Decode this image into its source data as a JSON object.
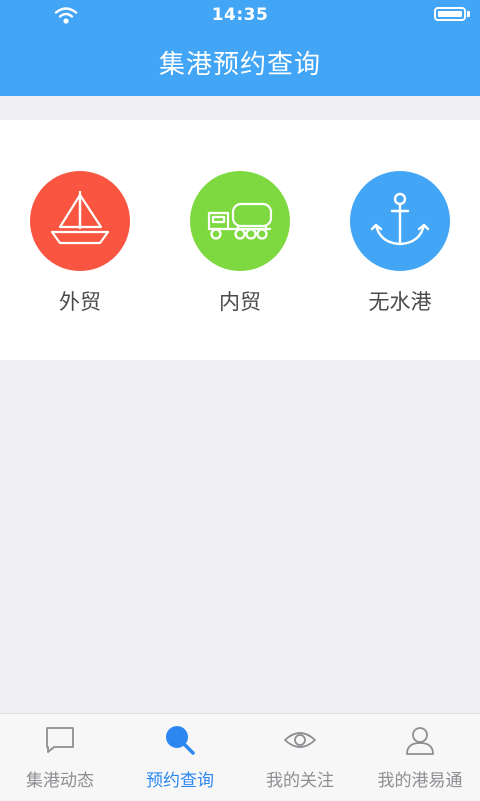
{
  "status_bar": {
    "time": "14:35"
  },
  "header": {
    "title": "集港预约查询"
  },
  "menu": [
    {
      "label": "外贸",
      "icon": "sailboat-icon",
      "color": "#fa5540"
    },
    {
      "label": "内贸",
      "icon": "truck-icon",
      "color": "#7ed940"
    },
    {
      "label": "无水港",
      "icon": "anchor-icon",
      "color": "#42a5f5"
    }
  ],
  "tabs": [
    {
      "label": "集港动态",
      "icon": "chat-bubble-icon",
      "active": false
    },
    {
      "label": "预约查询",
      "icon": "search-icon",
      "active": true
    },
    {
      "label": "我的关注",
      "icon": "eye-icon",
      "active": false
    },
    {
      "label": "我的港易通",
      "icon": "user-icon",
      "active": false
    }
  ],
  "colors": {
    "header": "#42a5f5",
    "background": "#efeff4",
    "tab_active": "#2c87f0",
    "tab_inactive": "#8e8e93"
  }
}
